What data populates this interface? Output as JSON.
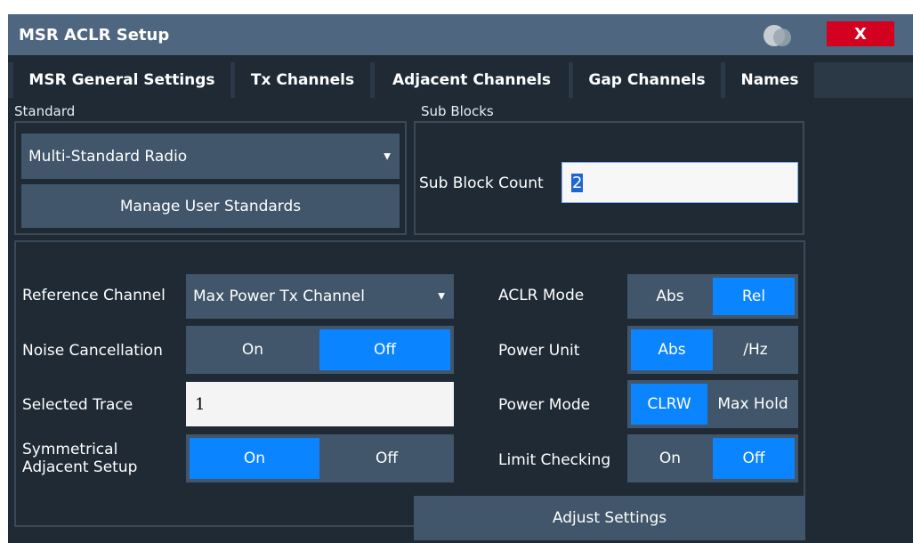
{
  "dialog": {
    "title": "MSR ACLR Setup",
    "close_label": "X",
    "colors": {
      "accent": "#0a84ff",
      "close": "#d4001f",
      "title_bar": "#4e6680",
      "background": "#1f2a35",
      "control": "#41566a"
    }
  },
  "tabs": [
    {
      "label": "MSR General Settings",
      "active": true
    },
    {
      "label": "Tx Channels",
      "active": false
    },
    {
      "label": "Adjacent Channels",
      "active": false
    },
    {
      "label": "Gap Channels",
      "active": false
    },
    {
      "label": "Names",
      "active": false
    }
  ],
  "standard": {
    "group_label": "Standard",
    "selected": "Multi-Standard Radio",
    "manage_button": "Manage User Standards"
  },
  "sub_blocks": {
    "group_label": "Sub Blocks",
    "count_label": "Sub Block Count",
    "count_value": "2"
  },
  "left_settings": {
    "reference_channel": {
      "label": "Reference Channel",
      "value": "Max Power Tx Channel"
    },
    "noise_cancellation": {
      "label": "Noise Cancellation",
      "options": [
        "On",
        "Off"
      ],
      "selected": "Off"
    },
    "selected_trace": {
      "label": "Selected Trace",
      "value": "1"
    },
    "symmetrical": {
      "label_line1": "Symmetrical",
      "label_line2": "Adjacent Setup",
      "options": [
        "On",
        "Off"
      ],
      "selected": "On"
    }
  },
  "right_settings": {
    "aclr_mode": {
      "label": "ACLR Mode",
      "options": [
        "Abs",
        "Rel"
      ],
      "selected": "Rel"
    },
    "power_unit": {
      "label": "Power Unit",
      "options": [
        "Abs",
        "/Hz"
      ],
      "selected": "Abs"
    },
    "power_mode": {
      "label": "Power Mode",
      "options": [
        "CLRW",
        "Max Hold"
      ],
      "selected": "CLRW"
    },
    "limit_checking": {
      "label": "Limit Checking",
      "options": [
        "On",
        "Off"
      ],
      "selected": "Off"
    }
  },
  "adjust_button": "Adjust Settings"
}
